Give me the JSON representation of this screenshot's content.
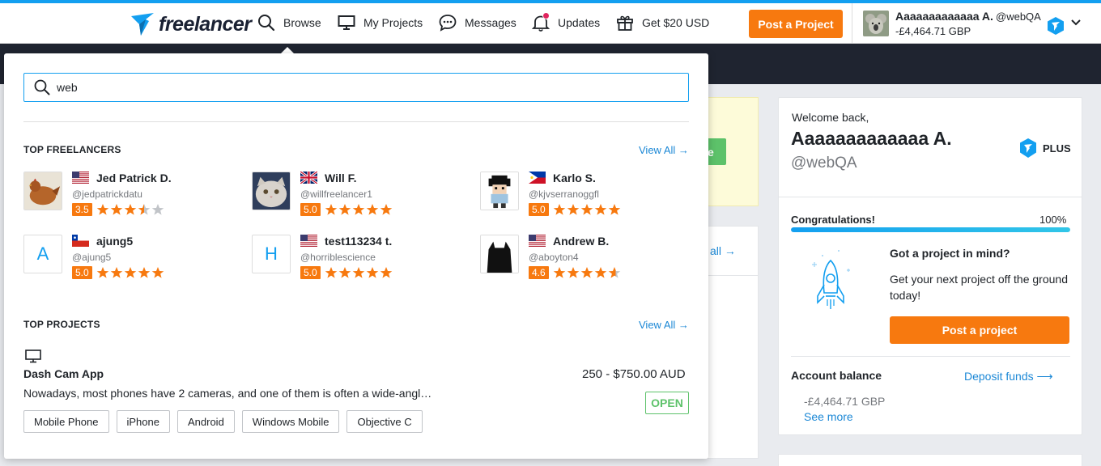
{
  "header": {
    "logo_text": "freelancer",
    "nav": [
      {
        "label": "Browse",
        "icon": "search-icon"
      },
      {
        "label": "My Projects",
        "icon": "monitor-icon"
      },
      {
        "label": "Messages",
        "icon": "chat-icon"
      },
      {
        "label": "Updates",
        "icon": "bell-icon"
      },
      {
        "label": "Get $20 USD",
        "icon": "gift-icon"
      }
    ],
    "post_project_label": "Post a Project",
    "account": {
      "name": "Aaaaaaaaaaaaa A.",
      "handle": "@webQA",
      "balance": "-£4,464.71 GBP"
    }
  },
  "search": {
    "value": "web",
    "top_freelancers_title": "TOP FREELANCERS",
    "view_all_label": "View All →",
    "freelancers": [
      {
        "name": "Jed Patrick D.",
        "handle": "@jedpatrickdatu",
        "rating": "3.5",
        "stars": 3.5,
        "flag": "us",
        "avatar": "photo"
      },
      {
        "name": "Will F.",
        "handle": "@willfreelancer1",
        "rating": "5.0",
        "stars": 5,
        "flag": "uk",
        "avatar": "photo"
      },
      {
        "name": "Karlo S.",
        "handle": "@kjvserranoggfl",
        "rating": "5.0",
        "stars": 5,
        "flag": "ph",
        "avatar": "photo"
      },
      {
        "name": "ajung5",
        "handle": "@ajung5",
        "rating": "5.0",
        "stars": 5,
        "flag": "cl",
        "avatar": "A"
      },
      {
        "name": "test113234 t.",
        "handle": "@horriblescience",
        "rating": "5.0",
        "stars": 5,
        "flag": "us",
        "avatar": "H"
      },
      {
        "name": "Andrew B.",
        "handle": "@aboyton4",
        "rating": "4.6",
        "stars": 4.6,
        "flag": "us",
        "avatar": "photo"
      }
    ],
    "top_projects_title": "TOP PROJECTS",
    "project": {
      "title": "Dash Cam App",
      "price": "250 - $750.00 AUD",
      "description": "Nowadays, most phones have 2 cameras, and one of them is often a wide-angl…",
      "status": "OPEN",
      "tags": [
        "Mobile Phone",
        "iPhone",
        "Android",
        "Windows Mobile",
        "Objective C"
      ]
    }
  },
  "background": {
    "green_button_partial": "e",
    "card_link_partial": "all →"
  },
  "sidebar": {
    "welcome": "Welcome back,",
    "name": "Aaaaaaaaaaaaa A.",
    "handle": "@webQA",
    "membership": "PLUS",
    "congrats": "Congratulations!",
    "progress_label": "100%",
    "progress_fraction": 1.0,
    "project_prompt_title": "Got a project in mind?",
    "project_prompt_text": "Get your next project off the ground today!",
    "post_project_label": "Post a project",
    "account_balance_label": "Account balance",
    "deposit_label": "Deposit funds ⟶",
    "balance": "-£4,464.71 GBP",
    "see_more": "See more"
  },
  "colors": {
    "accent_blue": "#139ff0",
    "cta_orange": "#f7790f",
    "link_blue": "#1c88d6",
    "open_green": "#5dc26a",
    "dark_band": "#1f2430"
  }
}
